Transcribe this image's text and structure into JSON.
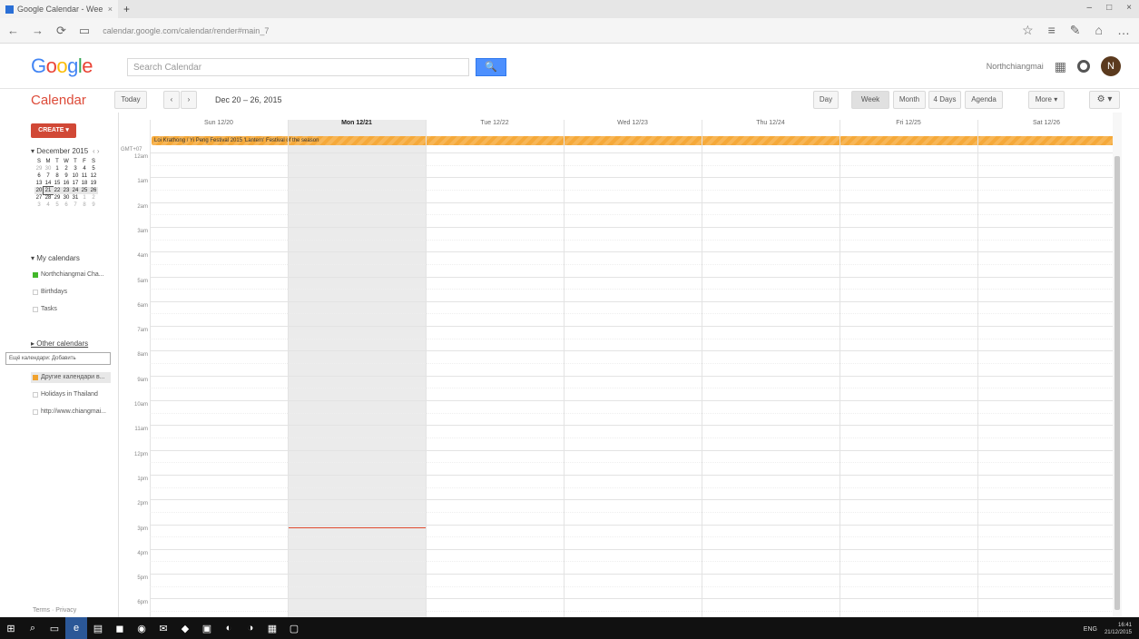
{
  "browser": {
    "tab_title": "Google Calendar - Wee",
    "tab_close": "×",
    "new_tab": "+",
    "window_controls": [
      "–",
      "□",
      "×"
    ],
    "nav_buttons": [
      "←",
      "→",
      "⟳",
      "▭"
    ],
    "url": "calendar.google.com/calendar/render#main_7",
    "right_icons": [
      "☆",
      "≡",
      "✎",
      "⌂",
      "…"
    ]
  },
  "google": {
    "logo_letters": [
      {
        "ch": "G",
        "color": "#4285f4"
      },
      {
        "ch": "o",
        "color": "#ea4335"
      },
      {
        "ch": "o",
        "color": "#fbbc05"
      },
      {
        "ch": "g",
        "color": "#4285f4"
      },
      {
        "ch": "l",
        "color": "#34a853"
      },
      {
        "ch": "e",
        "color": "#ea4335"
      }
    ],
    "search_placeholder": "Search Calendar",
    "search_icon": "🔍",
    "account_name": "Northchiangmai",
    "apps_icon": "▦",
    "avatar_letter": "N"
  },
  "toolbar": {
    "app_title": "Calendar",
    "today_label": "Today",
    "prev": "‹",
    "next": "›",
    "date_range": "Dec 20 – 26, 2015",
    "views": [
      "Day",
      "Week",
      "Month",
      "4 Days",
      "Agenda"
    ],
    "more_label": "More ▾",
    "settings_icon": "⚙ ▾"
  },
  "sidebar": {
    "create_label": "CREATE ▾",
    "mini_month": "▾ December 2015",
    "mini_nav": "‹  ›",
    "weekdays": [
      "S",
      "M",
      "T",
      "W",
      "T",
      "F",
      "S"
    ],
    "weeks": [
      [
        "29",
        "30",
        "1",
        "2",
        "3",
        "4",
        "5"
      ],
      [
        "6",
        "7",
        "8",
        "9",
        "10",
        "11",
        "12"
      ],
      [
        "13",
        "14",
        "15",
        "16",
        "17",
        "18",
        "19"
      ],
      [
        "20",
        "21",
        "22",
        "23",
        "24",
        "25",
        "26"
      ],
      [
        "27",
        "28",
        "29",
        "30",
        "31",
        "1",
        "2"
      ],
      [
        "3",
        "4",
        "5",
        "6",
        "7",
        "8",
        "9"
      ]
    ],
    "my_calendars_label": "▾ My calendars",
    "my_calendars": [
      {
        "name": "Northchiangmai Cha...",
        "swatch": "green"
      },
      {
        "name": "Birthdays",
        "swatch": "none"
      },
      {
        "name": "Tasks",
        "swatch": "none"
      }
    ],
    "other_calendars_label": "▸ Other calendars",
    "tooltip": "Ещё календари: Добавить",
    "other_calendars": [
      {
        "name": "Другие календари в...",
        "swatch": "orange"
      },
      {
        "name": "Holidays in Thailand",
        "swatch": "none"
      },
      {
        "name": "http://www.chiangmai...",
        "swatch": "none"
      }
    ],
    "footer": "Terms · Privacy"
  },
  "calendar": {
    "timezone": "GMT+07",
    "days": [
      "Sun 12/20",
      "Mon 12/21",
      "Tue 12/22",
      "Wed 12/23",
      "Thu 12/24",
      "Fri 12/25",
      "Sat 12/26"
    ],
    "today_index": 1,
    "allday_event": "Loi Krathong / Yi Peng Festival 2015 'Lantern' Festival of the season",
    "hours": [
      "12am",
      "1am",
      "2am",
      "3am",
      "4am",
      "5am",
      "6am",
      "7am",
      "8am",
      "9am",
      "10am",
      "11am",
      "12pm",
      "1pm",
      "2pm",
      "3pm",
      "4pm",
      "5pm",
      "6pm"
    ]
  },
  "taskbar": {
    "start": "⊞",
    "icons": [
      "⌕",
      "▭",
      "e",
      "▤",
      "◼",
      "◉",
      "✉",
      "◆",
      "▣",
      "◐",
      "◑",
      "▦",
      "▢"
    ],
    "lang": "ENG",
    "time": "16:41",
    "date": "21/12/2015"
  }
}
